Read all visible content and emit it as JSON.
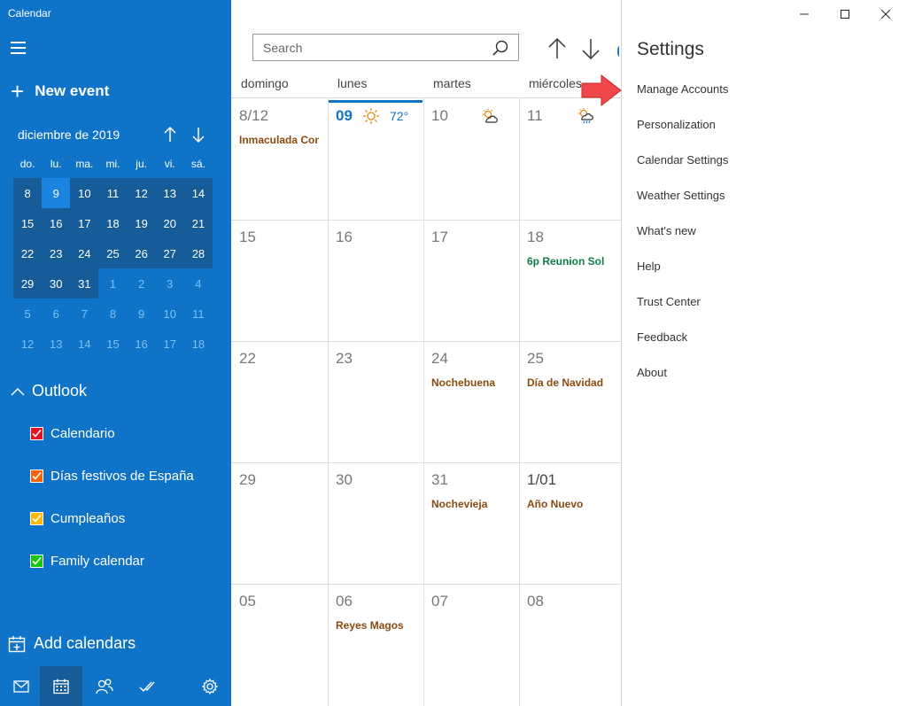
{
  "app": {
    "title": "Calendar"
  },
  "sidebar": {
    "new_event": "New event",
    "new_event_plus": "+",
    "month_label": "diciembre de 2019",
    "weekdays": [
      "do.",
      "lu.",
      "ma.",
      "mi.",
      "ju.",
      "vi.",
      "sá."
    ],
    "weeks": [
      [
        {
          "d": "8",
          "t": "cur"
        },
        {
          "d": "9",
          "t": "today"
        },
        {
          "d": "10",
          "t": "cur"
        },
        {
          "d": "11",
          "t": "cur"
        },
        {
          "d": "12",
          "t": "cur"
        },
        {
          "d": "13",
          "t": "cur"
        },
        {
          "d": "14",
          "t": "cur"
        }
      ],
      [
        {
          "d": "15",
          "t": "cur"
        },
        {
          "d": "16",
          "t": "cur"
        },
        {
          "d": "17",
          "t": "cur"
        },
        {
          "d": "18",
          "t": "cur"
        },
        {
          "d": "19",
          "t": "cur"
        },
        {
          "d": "20",
          "t": "cur"
        },
        {
          "d": "21",
          "t": "cur"
        }
      ],
      [
        {
          "d": "22",
          "t": "cur"
        },
        {
          "d": "23",
          "t": "cur"
        },
        {
          "d": "24",
          "t": "cur"
        },
        {
          "d": "25",
          "t": "cur"
        },
        {
          "d": "26",
          "t": "cur"
        },
        {
          "d": "27",
          "t": "cur"
        },
        {
          "d": "28",
          "t": "cur"
        }
      ],
      [
        {
          "d": "29",
          "t": "cur"
        },
        {
          "d": "30",
          "t": "cur"
        },
        {
          "d": "31",
          "t": "cur"
        },
        {
          "d": "1",
          "t": "other"
        },
        {
          "d": "2",
          "t": "other"
        },
        {
          "d": "3",
          "t": "other"
        },
        {
          "d": "4",
          "t": "other"
        }
      ],
      [
        {
          "d": "5",
          "t": "other"
        },
        {
          "d": "6",
          "t": "other"
        },
        {
          "d": "7",
          "t": "other"
        },
        {
          "d": "8",
          "t": "other"
        },
        {
          "d": "9",
          "t": "other"
        },
        {
          "d": "10",
          "t": "other"
        },
        {
          "d": "11",
          "t": "other"
        }
      ],
      [
        {
          "d": "12",
          "t": "other"
        },
        {
          "d": "13",
          "t": "other"
        },
        {
          "d": "14",
          "t": "other"
        },
        {
          "d": "15",
          "t": "other"
        },
        {
          "d": "16",
          "t": "other"
        },
        {
          "d": "17",
          "t": "other"
        },
        {
          "d": "18",
          "t": "other"
        }
      ]
    ],
    "account": "Outlook",
    "calendars": [
      {
        "label": "Calendario",
        "color": "#e81123"
      },
      {
        "label": "Días festivos de España",
        "color": "#f7630c"
      },
      {
        "label": "Cumpleaños",
        "color": "#ffb900"
      },
      {
        "label": "Family calendar",
        "color": "#16c60c"
      }
    ],
    "add_calendars": "Add calendars",
    "bottom_icons": [
      "mail-icon",
      "calendar-icon",
      "people-icon",
      "todo-icon",
      "settings-icon"
    ]
  },
  "search": {
    "placeholder": "Search"
  },
  "main": {
    "weekdays": [
      "domingo",
      "lunes",
      "martes",
      "miércoles"
    ],
    "weather_today": "72°",
    "rows": [
      [
        {
          "num": "8/12",
          "style": "",
          "events": [
            {
              "text": "Inmaculada Concepción",
              "color": "brown"
            }
          ]
        },
        {
          "num": "09",
          "style": "today",
          "events": []
        },
        {
          "num": "10",
          "style": "",
          "events": []
        },
        {
          "num": "11",
          "style": "",
          "events": []
        }
      ],
      [
        {
          "num": "15",
          "style": "",
          "events": []
        },
        {
          "num": "16",
          "style": "",
          "events": []
        },
        {
          "num": "17",
          "style": "",
          "events": []
        },
        {
          "num": "18",
          "style": "",
          "events": [
            {
              "text": "6p Reunion Sol",
              "color": "green"
            }
          ]
        }
      ],
      [
        {
          "num": "22",
          "style": "",
          "events": []
        },
        {
          "num": "23",
          "style": "",
          "events": []
        },
        {
          "num": "24",
          "style": "",
          "events": [
            {
              "text": "Nochebuena",
              "color": "brown"
            }
          ]
        },
        {
          "num": "25",
          "style": "",
          "events": [
            {
              "text": "Día de Navidad",
              "color": "brown"
            }
          ]
        }
      ],
      [
        {
          "num": "29",
          "style": "",
          "events": []
        },
        {
          "num": "30",
          "style": "",
          "events": []
        },
        {
          "num": "31",
          "style": "",
          "events": [
            {
              "text": "Nochevieja",
              "color": "brown"
            }
          ]
        },
        {
          "num": "1/01",
          "style": "cur",
          "events": [
            {
              "text": "Año Nuevo",
              "color": "brown"
            }
          ]
        }
      ],
      [
        {
          "num": "05",
          "style": "",
          "events": []
        },
        {
          "num": "06",
          "style": "",
          "events": [
            {
              "text": "Reyes Magos",
              "color": "brown"
            }
          ]
        },
        {
          "num": "07",
          "style": "",
          "events": []
        },
        {
          "num": "08",
          "style": "",
          "events": []
        }
      ]
    ]
  },
  "settings": {
    "title": "Settings",
    "items": [
      "Manage Accounts",
      "Personalization",
      "Calendar Settings",
      "Weather Settings",
      "What's new",
      "Help",
      "Trust Center",
      "Feedback",
      "About"
    ]
  }
}
